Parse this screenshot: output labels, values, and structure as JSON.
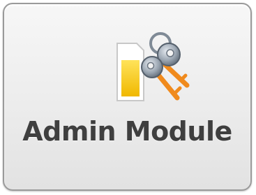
{
  "tile": {
    "label": "Admin Module",
    "icon": "keys-and-card-icon"
  },
  "colors": {
    "tile_border": "#9a9a9a",
    "tile_bg": "#ececec",
    "label_text": "#3f3f3f",
    "card_yellow": "#f2c500",
    "key_orange": "#f08a1c",
    "key_gray": "#8a95a2"
  }
}
